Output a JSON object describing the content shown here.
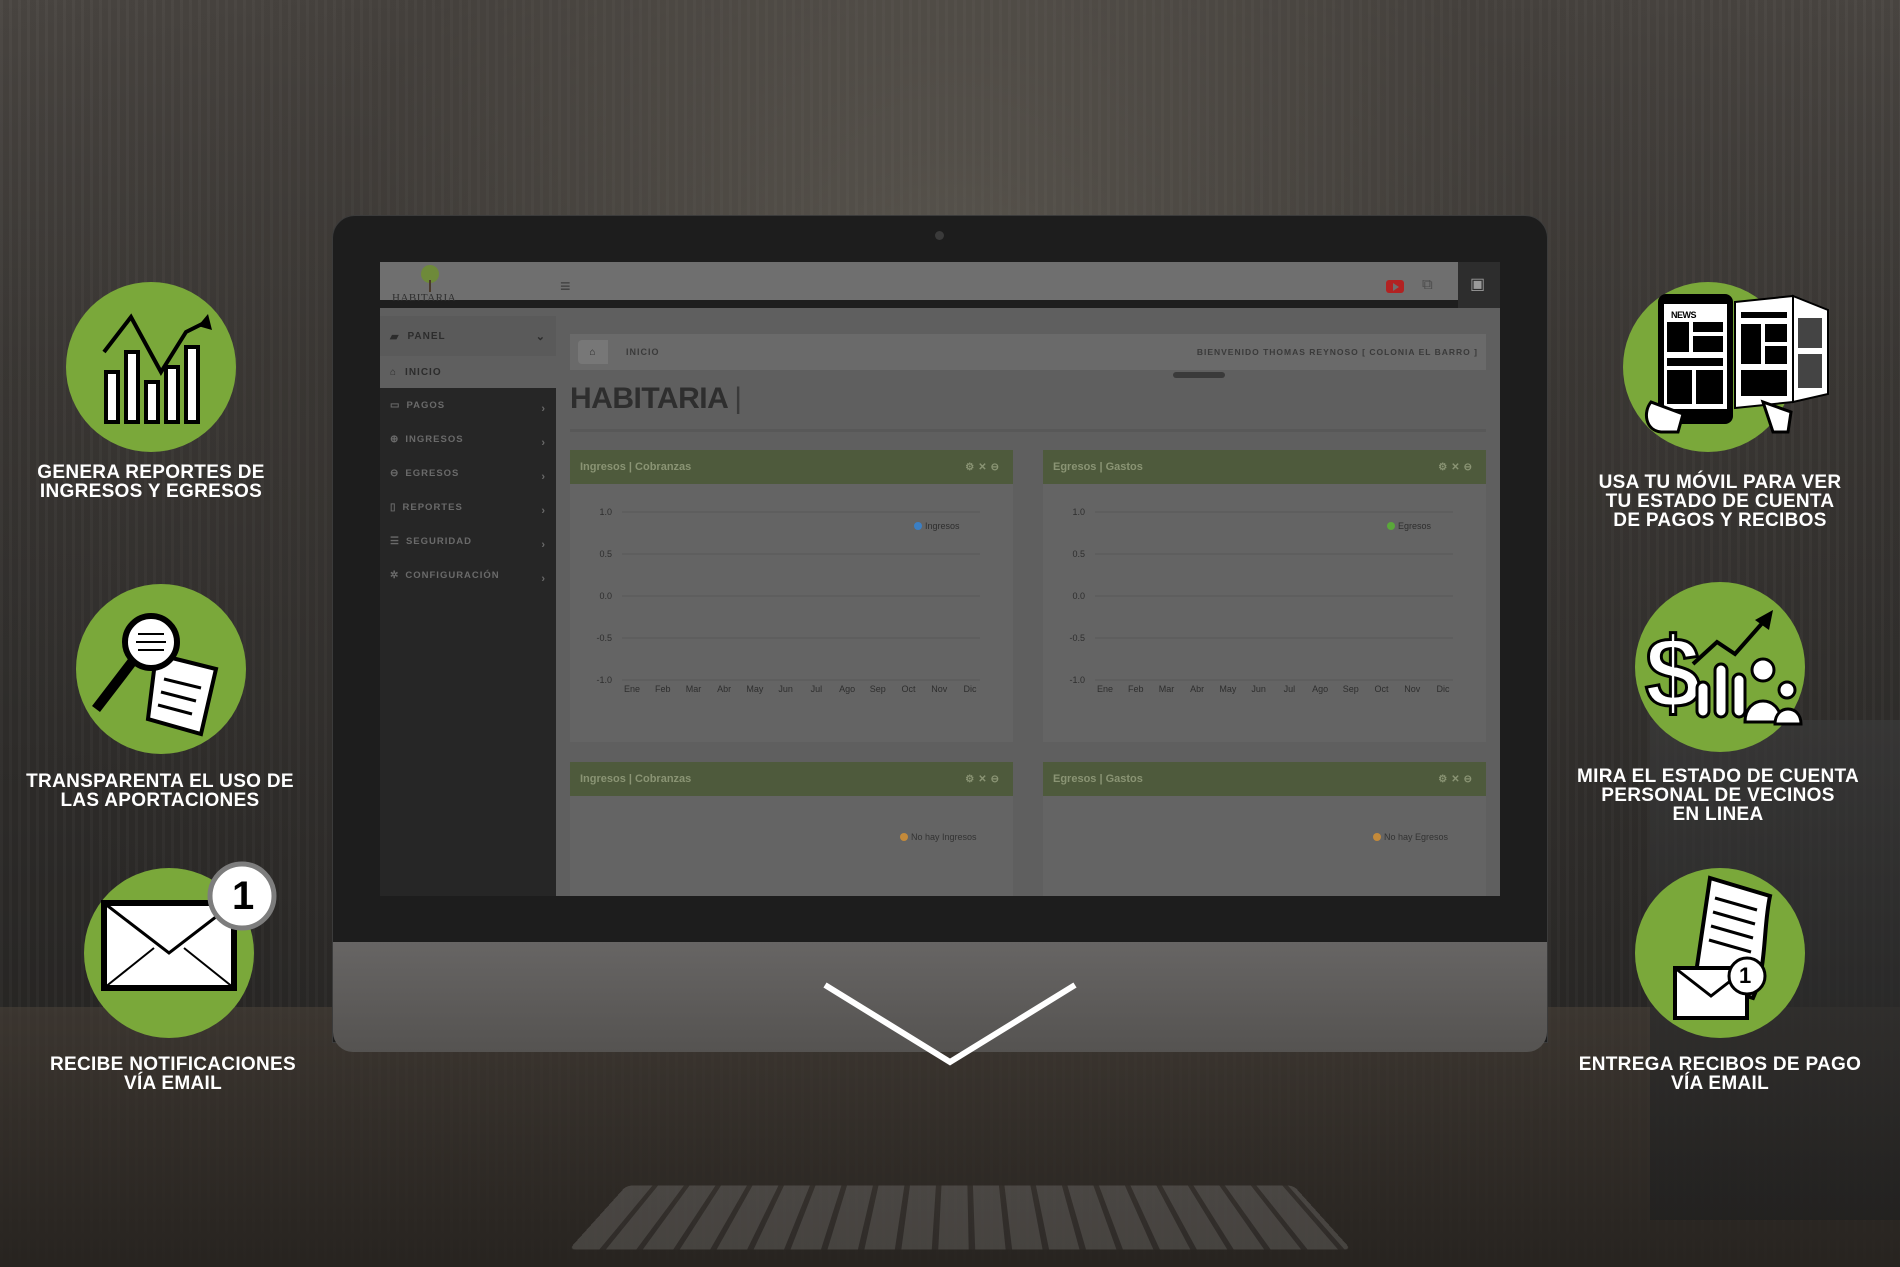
{
  "app": {
    "logo_text": "HABITARIA",
    "page_title": "HABITARIA",
    "title_cursor": "|"
  },
  "sidebar": {
    "panel_label": "PANEL",
    "inicio_label": "INICIO",
    "items": [
      {
        "label": "PAGOS",
        "icon": "money-icon"
      },
      {
        "label": "INGRESOS",
        "icon": "plus-circle-icon"
      },
      {
        "label": "EGRESOS",
        "icon": "minus-circle-icon"
      },
      {
        "label": "REPORTES",
        "icon": "file-icon"
      },
      {
        "label": "SEGURIDAD",
        "icon": "list-icon"
      },
      {
        "label": "CONFIGURACIÓN",
        "icon": "gear-icon"
      }
    ]
  },
  "breadcrumb": {
    "crumb": "INICIO",
    "welcome": "BIENVENIDO THOMAS REYNOSO [ COLONIA EL BARRO ]"
  },
  "widgets": [
    {
      "title": "Ingresos | Cobranzas",
      "legend": "Ingresos",
      "legend_color": "#3b7fc4"
    },
    {
      "title": "Egresos | Gastos",
      "legend": "Egresos",
      "legend_color": "#5aa83a"
    },
    {
      "title": "Ingresos | Cobranzas",
      "no_data": "No hay Ingresos"
    },
    {
      "title": "Egresos | Gastos",
      "no_data": "No hay Egresos"
    }
  ],
  "chart_data": [
    {
      "type": "line",
      "categories": [
        "Ene",
        "Feb",
        "Mar",
        "Abr",
        "May",
        "Jun",
        "Jul",
        "Ago",
        "Sep",
        "Oct",
        "Nov",
        "Dic"
      ],
      "y_ticks": [
        "1.0",
        "0.5",
        "0.0",
        "-0.5",
        "-1.0"
      ],
      "ylim": [
        -1.0,
        1.0
      ],
      "series": [
        {
          "name": "Ingresos",
          "values": []
        }
      ],
      "grid": true,
      "legend": "top-right"
    },
    {
      "type": "line",
      "categories": [
        "Ene",
        "Feb",
        "Mar",
        "Abr",
        "May",
        "Jun",
        "Jul",
        "Ago",
        "Sep",
        "Oct",
        "Nov",
        "Dic"
      ],
      "y_ticks": [
        "1.0",
        "0.5",
        "0.0",
        "-0.5",
        "-1.0"
      ],
      "ylim": [
        -1.0,
        1.0
      ],
      "series": [
        {
          "name": "Egresos",
          "values": []
        }
      ],
      "grid": true,
      "legend": "top-right"
    }
  ],
  "features": {
    "left": [
      {
        "caption_lines": [
          "GENERA REPORTES DE",
          "INGRESOS Y EGRESOS"
        ],
        "icon": "bar-chart-trend-icon"
      },
      {
        "caption_lines": [
          "TRANSPARENTA EL USO DE",
          "LAS APORTACIONES"
        ],
        "icon": "magnifier-document-icon"
      },
      {
        "caption_lines": [
          "RECIBE NOTIFICACIONES",
          "VÍA EMAIL"
        ],
        "icon": "envelope-notification-icon",
        "badge": "1"
      }
    ],
    "right": [
      {
        "caption_lines": [
          "USA TU MÓVIL PARA VER",
          "TU ESTADO DE CUENTA",
          "DE PAGOS Y RECIBOS"
        ],
        "icon": "mobile-newspaper-icon",
        "news_label": "NEWS"
      },
      {
        "caption_lines": [
          "MIRA EL ESTADO DE CUENTA",
          "PERSONAL DE VECINOS",
          "EN LINEA"
        ],
        "icon": "dollar-growth-people-icon"
      },
      {
        "caption_lines": [
          "ENTREGA RECIBOS DE PAGO",
          "VÍA EMAIL"
        ],
        "icon": "receipt-envelope-icon",
        "badge": "1"
      }
    ]
  },
  "colors": {
    "accent_green": "#7aa83a",
    "widget_header": "#4e5a3c"
  }
}
